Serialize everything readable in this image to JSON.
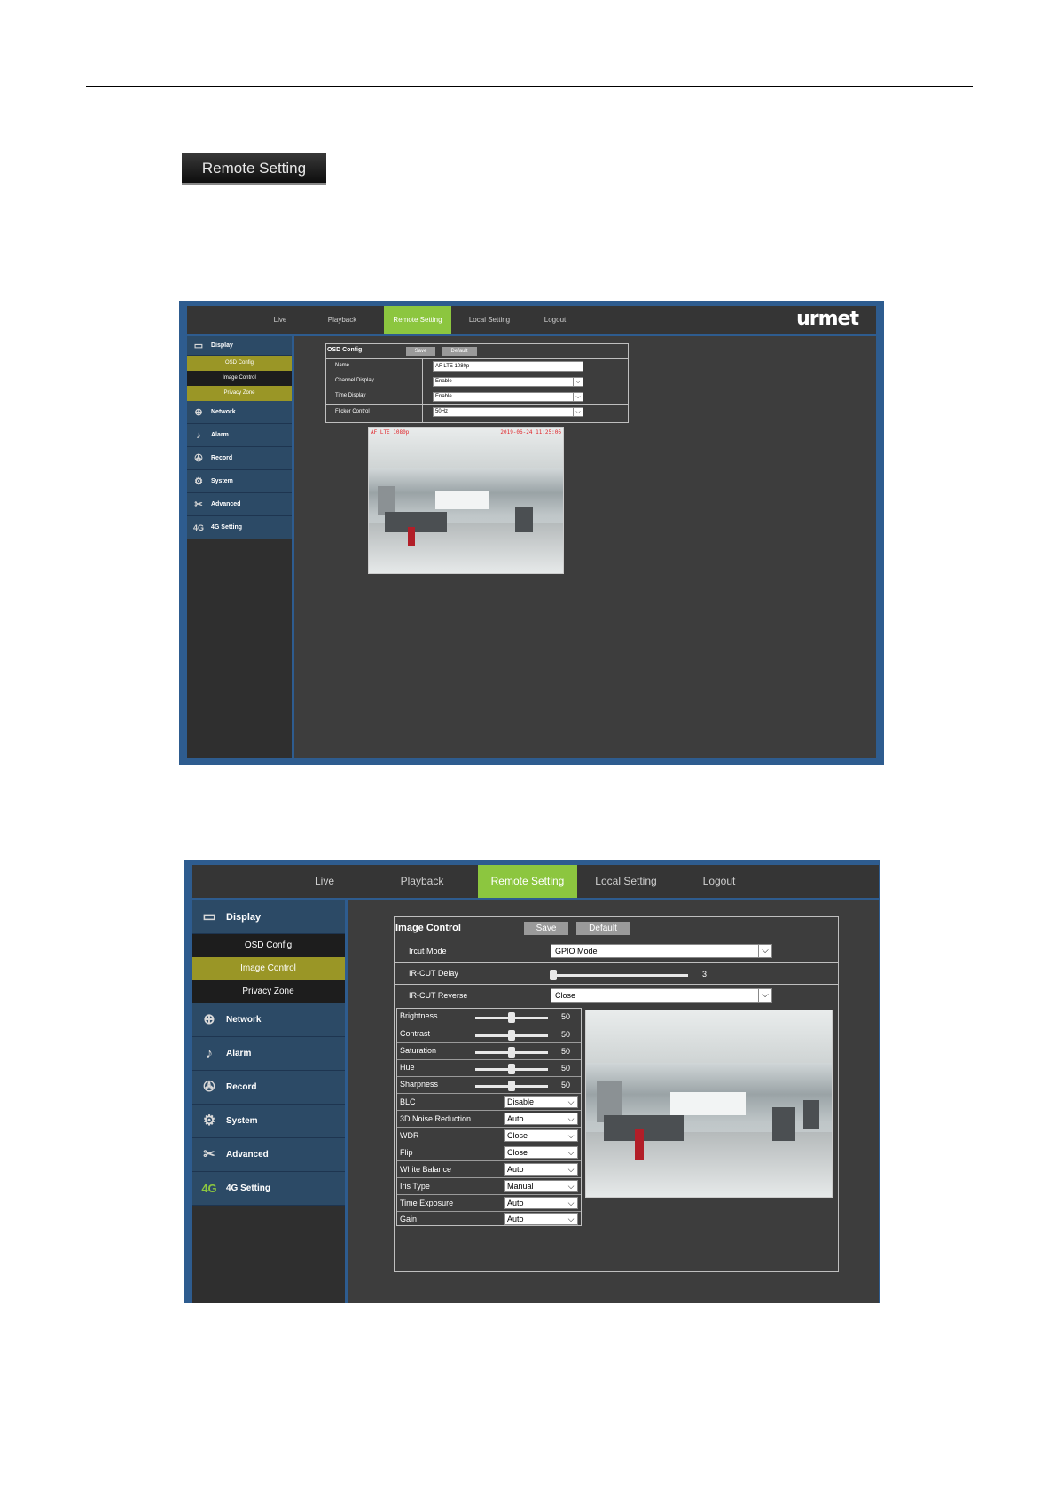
{
  "remote_button": {
    "label": "Remote Setting"
  },
  "nav": [
    {
      "label": "Live"
    },
    {
      "label": "Playback"
    },
    {
      "label": "Remote Setting"
    },
    {
      "label": "Local Setting"
    },
    {
      "label": "Logout"
    }
  ],
  "brand": {
    "logo": "urmet"
  },
  "sidebar": {
    "display": "Display",
    "subs": [
      "OSD Config",
      "Image Control",
      "Privacy Zone"
    ],
    "items": [
      "Network",
      "Alarm",
      "Record",
      "System",
      "Advanced",
      "4G Setting"
    ]
  },
  "osd": {
    "title": "OSD Config",
    "save": "Save",
    "default": "Default",
    "rows": [
      {
        "label": "Name",
        "value": "AF LTE 1080p"
      },
      {
        "label": "Channel Display",
        "value": "Enable"
      },
      {
        "label": "Time Display",
        "value": "Enable"
      },
      {
        "label": "Flicker Control",
        "value": "50Hz"
      }
    ],
    "overlay_left": "AF LTE 1080p",
    "overlay_right": "2019-06-24 11:25:06"
  },
  "image_control": {
    "title": "Image Control",
    "save": "Save",
    "default": "Default",
    "ircut_mode": {
      "label": "Ircut Mode",
      "value": "GPIO Mode"
    },
    "ircut_delay": {
      "label": "IR-CUT Delay",
      "value": "3",
      "fraction": 0.02
    },
    "ircut_reverse": {
      "label": "IR-CUT Reverse",
      "value": "Close"
    },
    "sliders": [
      {
        "label": "Brightness",
        "value": "50",
        "fraction": 0.5
      },
      {
        "label": "Contrast",
        "value": "50",
        "fraction": 0.5
      },
      {
        "label": "Saturation",
        "value": "50",
        "fraction": 0.5
      },
      {
        "label": "Hue",
        "value": "50",
        "fraction": 0.5
      },
      {
        "label": "Sharpness",
        "value": "50",
        "fraction": 0.5
      }
    ],
    "selects": [
      {
        "label": "BLC",
        "value": "Disable"
      },
      {
        "label": "3D Noise Reduction",
        "value": "Auto"
      },
      {
        "label": "WDR",
        "value": "Close"
      },
      {
        "label": "Flip",
        "value": "Close"
      },
      {
        "label": "White Balance",
        "value": "Auto"
      },
      {
        "label": "Iris Type",
        "value": "Manual"
      },
      {
        "label": "Time Exposure",
        "value": "Auto"
      },
      {
        "label": "Gain",
        "value": "Auto"
      }
    ]
  }
}
